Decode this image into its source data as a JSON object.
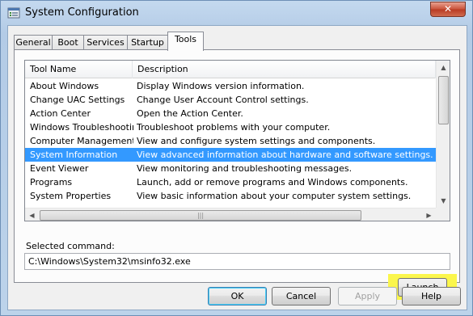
{
  "window": {
    "title": "System Configuration",
    "close_glyph": "✕"
  },
  "tabs": [
    {
      "label": "General"
    },
    {
      "label": "Boot"
    },
    {
      "label": "Services"
    },
    {
      "label": "Startup"
    },
    {
      "label": "Tools",
      "active": true
    }
  ],
  "list": {
    "columns": [
      "Tool Name",
      "Description"
    ],
    "rows": [
      {
        "name": "About Windows",
        "desc": "Display Windows version information."
      },
      {
        "name": "Change UAC Settings",
        "desc": "Change User Account Control settings."
      },
      {
        "name": "Action Center",
        "desc": "Open the Action Center."
      },
      {
        "name": "Windows Troubleshooting",
        "desc": "Troubleshoot problems with your computer."
      },
      {
        "name": "Computer Management",
        "desc": "View and configure system settings and components."
      },
      {
        "name": "System Information",
        "desc": "View advanced information about hardware and software settings.",
        "selected": true
      },
      {
        "name": "Event Viewer",
        "desc": "View monitoring and troubleshooting messages."
      },
      {
        "name": "Programs",
        "desc": "Launch, add or remove programs and Windows components."
      },
      {
        "name": "System Properties",
        "desc": "View basic information about your computer system settings."
      }
    ]
  },
  "selected_command": {
    "label": "Selected command:",
    "value": "C:\\Windows\\System32\\msinfo32.exe"
  },
  "buttons": {
    "launch": "Launch",
    "ok": "OK",
    "cancel": "Cancel",
    "apply": "Apply",
    "help": "Help"
  },
  "colors": {
    "selection": "#3399ff",
    "highlight": "#fbf64c",
    "close_button": "#c9523a"
  },
  "icons": {
    "app": "system-configuration-icon",
    "scroll_up": "arrow-up-icon",
    "scroll_down": "arrow-down-icon",
    "scroll_left": "arrow-left-icon",
    "scroll_right": "arrow-right-icon"
  }
}
